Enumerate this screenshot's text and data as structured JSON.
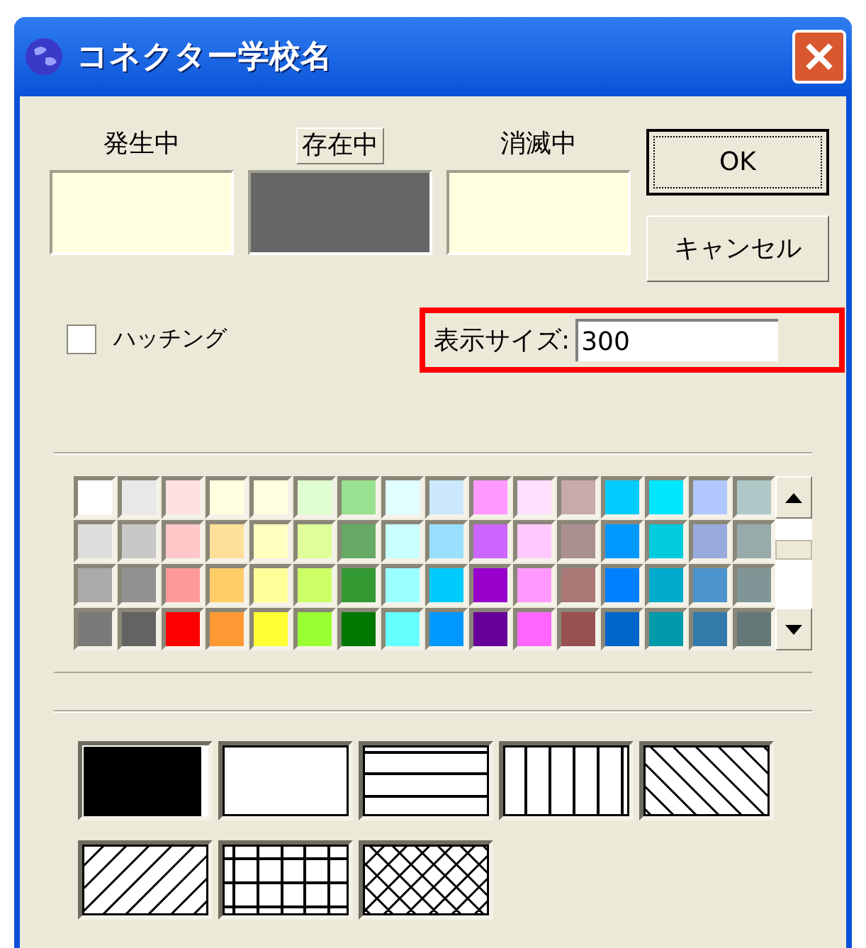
{
  "window": {
    "title": "コネクター学校名"
  },
  "states": [
    {
      "label": "発生中",
      "color": "#ffffe0",
      "selected": false
    },
    {
      "label": "存在中",
      "color": "#666666",
      "selected": true
    },
    {
      "label": "消滅中",
      "color": "#ffffe0",
      "selected": false
    }
  ],
  "buttons": [
    {
      "label": "OK",
      "default": true
    },
    {
      "label": "キャンセル",
      "default": false
    }
  ],
  "hatching": {
    "label": "ハッチング",
    "checked": false
  },
  "display_size": {
    "label": "表示サイズ:",
    "value": "300",
    "highlighted": true
  },
  "palette": {
    "rows": [
      [
        {
          "color": "#ffffff"
        },
        {
          "color": "#e8e8e8"
        },
        {
          "color": "#ffe0e0"
        },
        {
          "color": "#ffffe0"
        },
        {
          "color": "#fffee0"
        },
        {
          "color": "#e0ffd0"
        },
        {
          "color": "#99e090"
        },
        {
          "color": "#e0ffff"
        },
        {
          "color": "#cce8ff"
        },
        {
          "color": "#ff99ff"
        },
        {
          "color": "#ffe0ff"
        },
        {
          "color": "#c8aaaa"
        },
        {
          "color": "#00ccff"
        },
        {
          "color": "#00e6ff"
        },
        {
          "color": "#b0c8ff"
        },
        {
          "color": "#b0c8c8"
        }
      ],
      [
        {
          "color": "#dddddd"
        },
        {
          "color": "#c8c8c8"
        },
        {
          "color": "#ffc8c8"
        },
        {
          "color": "#ffe099"
        },
        {
          "color": "#ffffc0"
        },
        {
          "color": "#e0ff99"
        },
        {
          "color": "#66aa66"
        },
        {
          "color": "#c8ffff"
        },
        {
          "color": "#99e0ff"
        },
        {
          "color": "#cc66ff"
        },
        {
          "color": "#ffc8ff"
        },
        {
          "color": "#aa9090"
        },
        {
          "color": "#0099ff"
        },
        {
          "color": "#00ccdd"
        },
        {
          "color": "#99aadd"
        },
        {
          "color": "#99aaaa"
        }
      ],
      [
        {
          "color": "#aaaaaa"
        },
        {
          "color": "#919191"
        },
        {
          "color": "#ff9999"
        },
        {
          "color": "#ffcc66"
        },
        {
          "color": "#ffff99"
        },
        {
          "color": "#ccff66"
        },
        {
          "color": "#339933"
        },
        {
          "color": "#99ffff"
        },
        {
          "color": "#00cbff"
        },
        {
          "color": "#9900cc"
        },
        {
          "color": "#ff98ff"
        },
        {
          "color": "#aa7777"
        },
        {
          "color": "#0080ff"
        },
        {
          "color": "#00aacc"
        },
        {
          "color": "#4d94cc"
        },
        {
          "color": "#809595"
        }
      ],
      [
        {
          "color": "#7a7a7a"
        },
        {
          "color": "#636363"
        },
        {
          "color": "#ff0000"
        },
        {
          "color": "#ff9933"
        },
        {
          "color": "#ffff33"
        },
        {
          "color": "#99ff33"
        },
        {
          "color": "#007700"
        },
        {
          "color": "#66ffff"
        },
        {
          "color": "#0098ff"
        },
        {
          "color": "#660099"
        },
        {
          "color": "#ff66ff"
        },
        {
          "color": "#995050"
        },
        {
          "color": "#0066cc"
        },
        {
          "color": "#0099aa"
        },
        {
          "color": "#337aaa"
        },
        {
          "color": "#667777"
        }
      ]
    ]
  },
  "patterns": [
    {
      "kind": "solid"
    },
    {
      "kind": "blank"
    },
    {
      "kind": "horizontal"
    },
    {
      "kind": "vertical"
    },
    {
      "kind": "diagonal_down"
    },
    {
      "kind": "diagonal_up"
    },
    {
      "kind": "grid"
    },
    {
      "kind": "crosshatch"
    }
  ]
}
